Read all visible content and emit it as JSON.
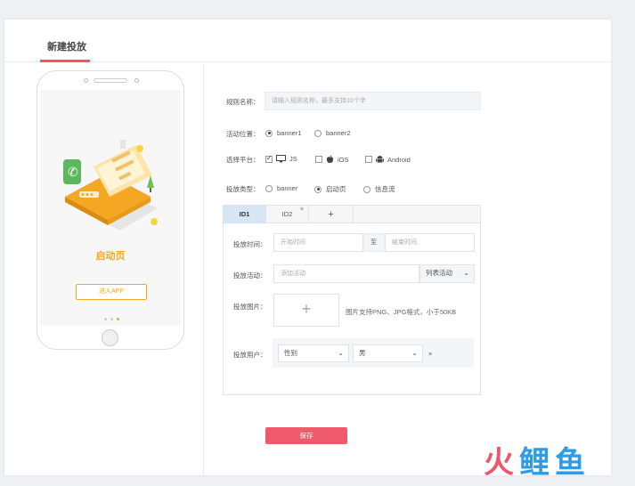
{
  "header": {
    "title": "新建投放"
  },
  "preview": {
    "screen_title": "启动页",
    "enter_button": "进入APP",
    "page_dots": 3,
    "active_dot": 3
  },
  "form": {
    "rule_name": {
      "label": "规则名称：",
      "placeholder": "请输入规则名称，最多支持10个字"
    },
    "position": {
      "label": "活动位置：",
      "options": [
        "banner1",
        "banner2"
      ],
      "selected": "banner1"
    },
    "platform": {
      "label": "选择平台：",
      "options": [
        {
          "label": "JS",
          "icon": "monitor-icon",
          "checked": true
        },
        {
          "label": "iOS",
          "icon": "apple-icon",
          "checked": false
        },
        {
          "label": "Android",
          "icon": "android-icon",
          "checked": false
        }
      ]
    },
    "type": {
      "label": "投放类型：",
      "options": [
        "banner",
        "启动页",
        "信息流"
      ],
      "selected": "启动页"
    },
    "tabs": [
      {
        "label": "ID1",
        "active": true
      },
      {
        "label": "ID2",
        "active": false,
        "close": "×"
      },
      {
        "label": "+",
        "active": false
      }
    ],
    "time": {
      "label": "投放时间：",
      "start_placeholder": "开始时间",
      "separator": "至",
      "end_placeholder": "结束时间"
    },
    "activity": {
      "label": "投放活动：",
      "placeholder": "添加活动",
      "list_label": "列表活动"
    },
    "image": {
      "label": "投放图片：",
      "plus": "+",
      "hint": "图片支持PNG、JPG格式，小于50KB"
    },
    "users": {
      "label": "投放用户：",
      "gender_label": "性别",
      "gender_value": "男",
      "remove": "×"
    }
  },
  "actions": {
    "save": "保存"
  },
  "watermark": {
    "chars": [
      "火",
      "鲤",
      "鱼"
    ],
    "colors": [
      "#f0566a",
      "#2e9be6",
      "#2e9be6"
    ]
  }
}
